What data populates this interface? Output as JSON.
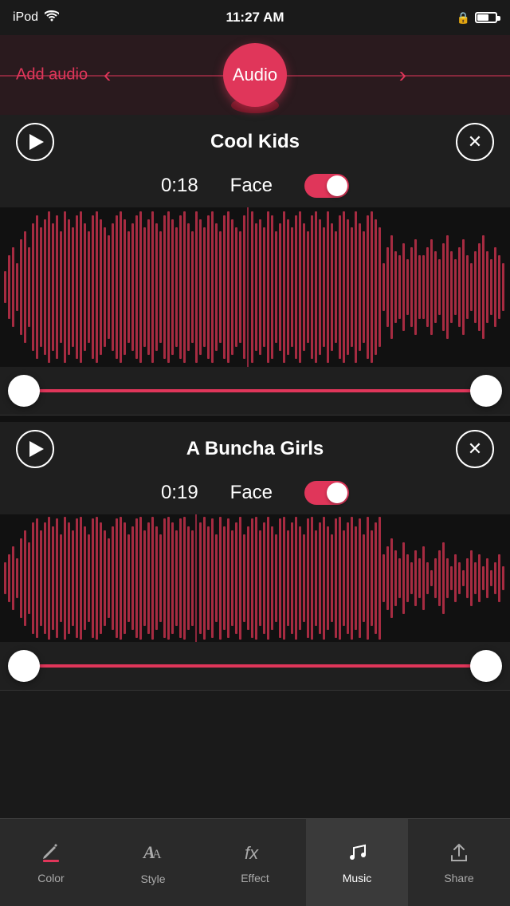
{
  "statusBar": {
    "device": "iPod",
    "time": "11:27 AM"
  },
  "header": {
    "addAudioLabel": "Add audio",
    "centerLabel": "Audio"
  },
  "tracks": [
    {
      "title": "Cool Kids",
      "time": "0:18",
      "faceLabel": "Face",
      "faceEnabled": true
    },
    {
      "title": "A Buncha Girls",
      "time": "0:19",
      "faceLabel": "Face",
      "faceEnabled": true
    }
  ],
  "tabBar": {
    "items": [
      {
        "id": "color",
        "label": "Color",
        "icon": "pencil"
      },
      {
        "id": "style",
        "label": "Style",
        "icon": "text-style"
      },
      {
        "id": "effect",
        "label": "Effect",
        "icon": "fx"
      },
      {
        "id": "music",
        "label": "Music",
        "icon": "music",
        "active": true
      },
      {
        "id": "share",
        "label": "Share",
        "icon": "cloud-upload"
      }
    ]
  }
}
